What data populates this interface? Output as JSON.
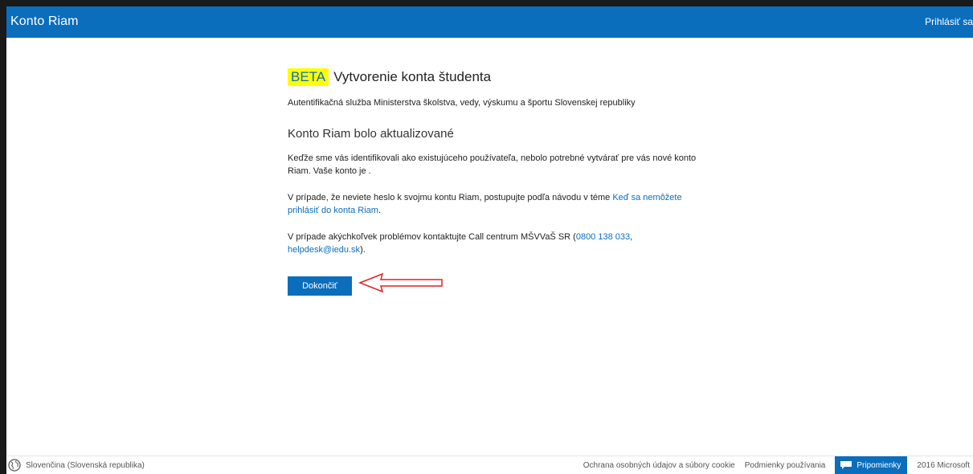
{
  "header": {
    "brand": "Konto Riam",
    "signin": "Prihlásiť sa"
  },
  "main": {
    "beta_badge": "BETA",
    "title": "Vytvorenie konta študenta",
    "subtitle": "Autentifikačná služba Ministerstva školstva, vedy, výskumu a športu Slovenskej republiky",
    "section_title": "Konto Riam bolo aktualizované",
    "para1": "Keďže sme vás identifikovali ako existujúceho používateľa, nebolo potrebné vytvárať pre vás nové konto Riam. Vaše konto je .",
    "para2_text": "V prípade, že neviete heslo k svojmu kontu Riam, postupujte podľa návodu v téme ",
    "para2_link": "Keď sa nemôžete prihlásiť do konta Riam",
    "para2_end": ".",
    "para3_text": "V prípade akýchkoľvek problémov kontaktujte Call centrum MŠVVaŠ SR (",
    "para3_phone": "0800 138 033",
    "para3_sep": ", ",
    "para3_email": "helpdesk@iedu.sk",
    "para3_end": ").",
    "finish_button": "Dokončiť"
  },
  "footer": {
    "language": "Slovenčina (Slovenská republika)",
    "privacy": "Ochrana osobných údajov a súbory cookie",
    "terms": "Podmienky používania",
    "feedback": "Pripomienky",
    "copyright": "2016 Microsoft"
  },
  "colors": {
    "accent": "#0a6ebd",
    "beta_highlight": "#ffff00",
    "annotation_arrow": "#e02020"
  },
  "icons": {
    "language": "globe-icon",
    "feedback": "speech-bubble-icon",
    "annotation": "arrow-left-icon"
  }
}
